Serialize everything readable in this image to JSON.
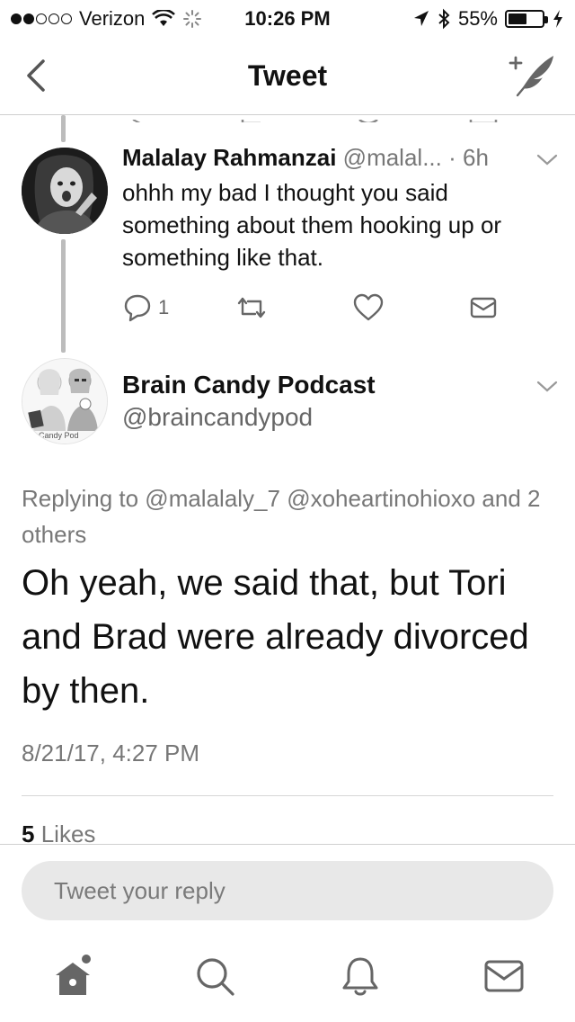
{
  "status_bar": {
    "carrier": "Verizon",
    "time": "10:26 PM",
    "battery": "55%",
    "battery_level": 0.55
  },
  "nav": {
    "title": "Tweet",
    "back_icon": "chevron-left-icon",
    "compose_icon": "compose-tweet-icon"
  },
  "reply_tweet": {
    "name": "Malalay Rahmanzai",
    "handle": "@malal...",
    "time": "· 6h",
    "text": "ohhh my bad I thought you said something about them hooking up or something like that.",
    "reply_count": "1"
  },
  "main_tweet": {
    "name": "Brain Candy Podcast",
    "handle": "@braincandypod",
    "avatar_caption": "Candy Pod",
    "replying_to": "Replying to @malalaly_7 @xoheartinohioxo and 2 others",
    "text": "Oh yeah, we said that, but Tori and Brad were already divorced by then.",
    "timestamp": "8/21/17, 4:27 PM",
    "likes_count": "5",
    "likes_label": "Likes"
  },
  "composer": {
    "placeholder": "Tweet your reply"
  },
  "tabs": [
    {
      "icon": "home-icon",
      "has_badge": true
    },
    {
      "icon": "search-icon"
    },
    {
      "icon": "notifications-bell-icon"
    },
    {
      "icon": "messages-envelope-icon"
    }
  ]
}
